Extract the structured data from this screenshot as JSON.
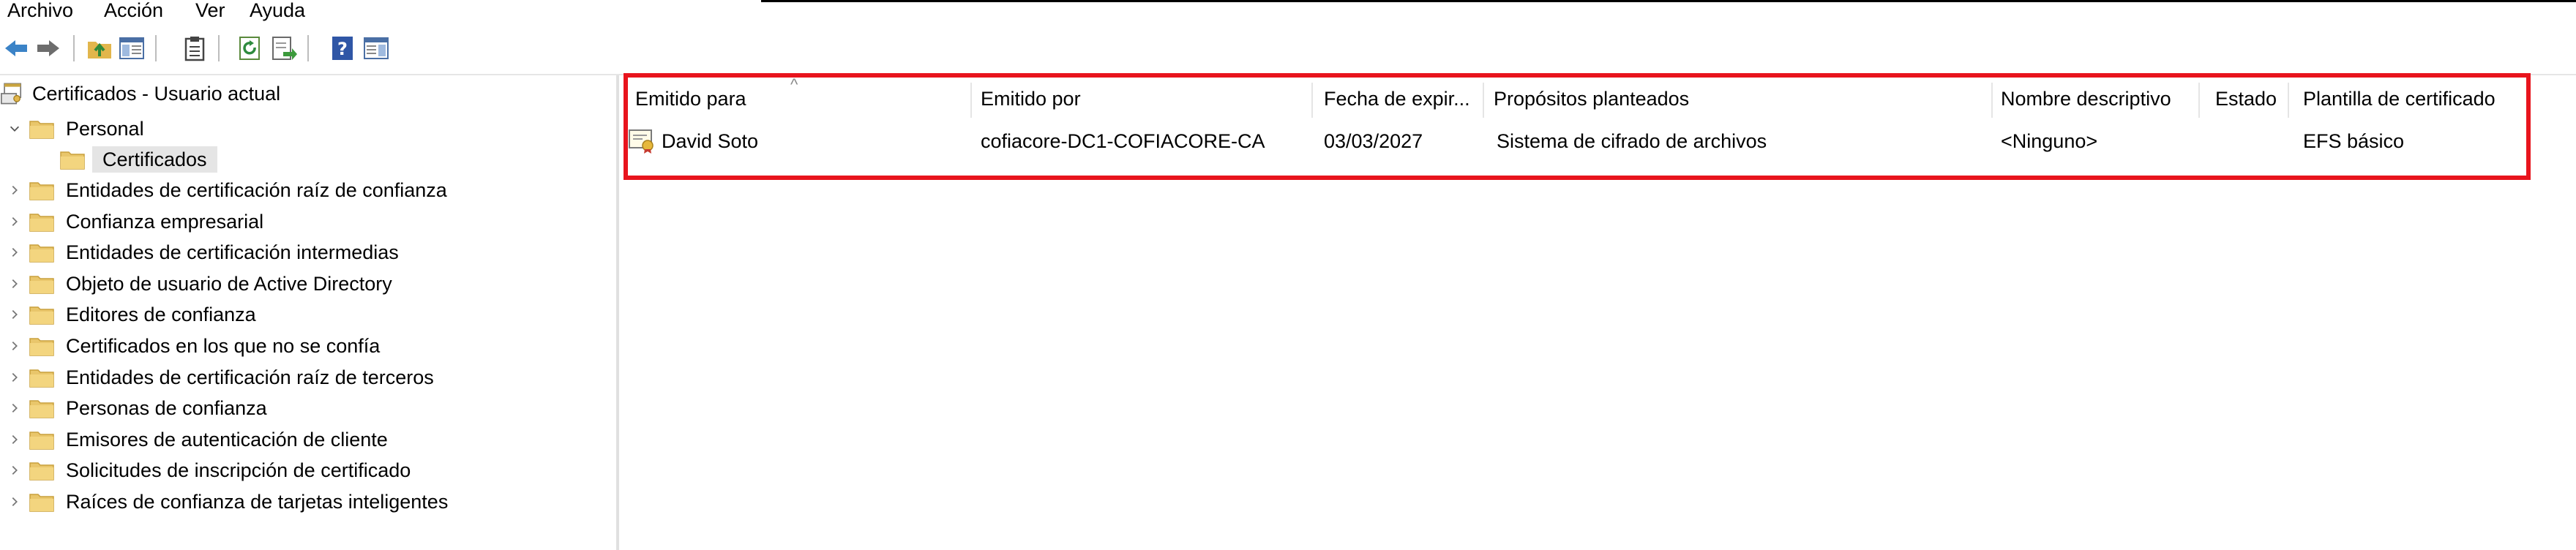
{
  "menu": {
    "items": [
      "Archivo",
      "Acción",
      "Ver",
      "Ayuda"
    ]
  },
  "toolbar": {
    "buttons": [
      "back-icon",
      "forward-icon",
      "up-folder-icon",
      "show-hide-tree-icon",
      "clipboard-icon",
      "refresh-icon",
      "export-list-icon",
      "help-icon",
      "properties-pane-icon"
    ]
  },
  "tree": {
    "root": "Certificados - Usuario actual",
    "personal": "Personal",
    "certificados": "Certificados",
    "nodes": [
      "Entidades de certificación raíz de confianza",
      "Confianza empresarial",
      "Entidades de certificación intermedias",
      "Objeto de usuario de Active Directory",
      "Editores de confianza",
      "Certificados en los que no se confía",
      "Entidades de certificación raíz de terceros",
      "Personas de confianza",
      "Emisores de autenticación de cliente",
      "Solicitudes de inscripción de certificado",
      "Raíces de confianza de tarjetas inteligentes"
    ]
  },
  "list": {
    "columns": [
      "Emitido para",
      "Emitido por",
      "Fecha de expir...",
      "Propósitos planteados",
      "Nombre descriptivo",
      "Estado",
      "Plantilla de certificado"
    ],
    "rows": [
      [
        "David Soto",
        "cofiacore-DC1-COFIACORE-CA",
        "03/03/2027",
        "Sistema de cifrado de archivos",
        "<Ninguno>",
        "",
        "EFS básico"
      ]
    ]
  },
  "colors": {
    "highlight": "#e8141d",
    "folder": "#e9c66b",
    "selection": "#e5e5e5"
  }
}
